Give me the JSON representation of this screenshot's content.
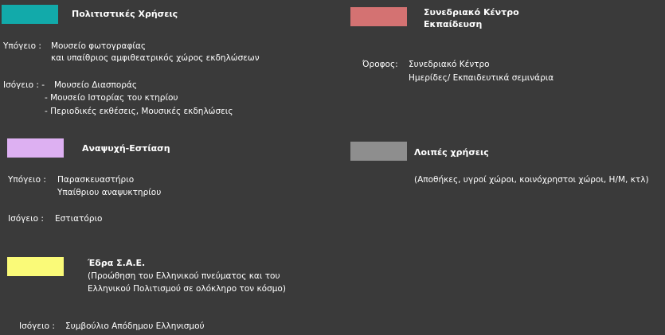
{
  "colors": {
    "background": "#3a3a3a",
    "cultural": "#12aaaa",
    "conference": "#d47272",
    "leisure": "#ddb0f2",
    "other": "#8e8e8e",
    "sae": "#fafa78"
  },
  "legend": {
    "cultural": {
      "title": "Πολιτιστικές Χρήσεις",
      "basement_label": "Υπόγειο :",
      "basement_line1": "Μουσείο φωτογραφίας",
      "basement_line2": "και υπαίθριος αμφιθεατρικός χώρος εκδηλώσεων",
      "ground_label": "Ισόγειο : -",
      "ground_item1": "Μουσείο Διασποράς",
      "ground_item2": "- Μουσείο Ιστορίας του κτηρίου",
      "ground_item3": "- Περιοδικές εκθέσεις, Μουσικές εκδηλώσεις"
    },
    "conference": {
      "title_line1": "Συνεδριακό Κέντρο",
      "title_line2": "Εκπαίδευση",
      "floor_label": "Όροφος:",
      "floor_line1": "Συνεδριακό Κέντρο",
      "floor_line2": "Ημερίδες/ Εκπαιδευτικά σεμινάρια"
    },
    "leisure": {
      "title": "Αναψυχή-Εστίαση",
      "basement_label": "Υπόγειο :",
      "basement_line1": "Παρασκευαστήριο",
      "basement_line2": "Υπαίθριου αναψυκτηρίου",
      "ground_label": "Ισόγειο :",
      "ground_line1": "Εστιατόριο"
    },
    "other": {
      "title": "Λοιπές χρήσεις",
      "description": "(Αποθήκες, υγροί χώροι, κοινόχρηστοι χώροι, Η/Μ, κτλ)"
    },
    "sae": {
      "title": "Έδρα Σ.Α.Ε.",
      "description_line1": "(Προώθηση του Ελληνικού πνεύματος και του",
      "description_line2": "Ελληνικού Πολιτισμού σε ολόκληρο τον κόσμο)",
      "ground_label": "Ισόγειο :",
      "ground_line1": "Συμβούλιο Απόδημου Ελληνισμού"
    }
  }
}
